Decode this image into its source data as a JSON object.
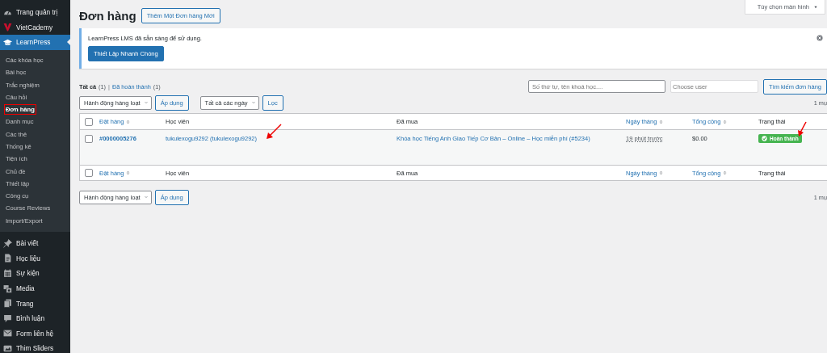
{
  "sidebar": {
    "items": [
      {
        "label": "Trang quản trị",
        "selected": false
      },
      {
        "label": "VietCademy",
        "selected": false
      },
      {
        "label": "LearnPress",
        "selected": true,
        "children": [
          {
            "label": "Các khóa học",
            "selected": false,
            "highlighted": false
          },
          {
            "label": "Bài học",
            "selected": false,
            "highlighted": false
          },
          {
            "label": "Trắc nghiệm",
            "selected": false,
            "highlighted": false
          },
          {
            "label": "Câu hỏi",
            "selected": false,
            "highlighted": false
          },
          {
            "label": "Đơn hàng",
            "selected": true,
            "highlighted": true
          },
          {
            "label": "Danh mục",
            "selected": false,
            "highlighted": false
          },
          {
            "label": "Các thẻ",
            "selected": false,
            "highlighted": false
          },
          {
            "label": "Thống kê",
            "selected": false,
            "highlighted": false
          },
          {
            "label": "Tiện ích",
            "selected": false,
            "highlighted": false
          },
          {
            "label": "Chủ đề",
            "selected": false,
            "highlighted": false
          },
          {
            "label": "Thiết lập",
            "selected": false,
            "highlighted": false
          },
          {
            "label": "Công cụ",
            "selected": false,
            "highlighted": false
          },
          {
            "label": "Course Reviews",
            "selected": false,
            "highlighted": false
          },
          {
            "label": "Import/Export",
            "selected": false,
            "highlighted": false
          }
        ]
      },
      {
        "label": "Bài viết",
        "selected": false
      },
      {
        "label": "Học liệu",
        "selected": false
      },
      {
        "label": "Sự kiện",
        "selected": false
      },
      {
        "label": "Media",
        "selected": false
      },
      {
        "label": "Trang",
        "selected": false
      },
      {
        "label": "Bình luận",
        "selected": false
      },
      {
        "label": "Form liên hệ",
        "selected": false
      },
      {
        "label": "Thim Sliders",
        "selected": false
      }
    ]
  },
  "screen_options": "Tùy chọn màn hình",
  "page_title": "Đơn hàng",
  "add_button": "Thêm Một Đơn hàng Mới",
  "notice": {
    "message": "LearnPress LMS đã sẵn sàng để sử dụng.",
    "button": "Thiết Lập Nhanh Chóng"
  },
  "views_separator": "|",
  "views": [
    {
      "label": "Tất cả",
      "count": "(1)",
      "selected": true
    },
    {
      "label": "Đã hoàn thành",
      "count": "(1)",
      "selected": false
    }
  ],
  "search": {
    "placeholder": "Số thứ tự, tên khoá học....",
    "user_placeholder": "Choose user",
    "button": "Tìm kiếm đơn hàng"
  },
  "top_actions": {
    "bulk": "Hành động hàng loạt",
    "apply": "Áp dụng",
    "date": "Tất cả các ngày",
    "filter": "Lọc",
    "count": "1 mụ"
  },
  "table": {
    "header_checked": false,
    "footer_checked": false,
    "columns": [
      {
        "label": "Đặt hàng",
        "sortable": true
      },
      {
        "label": "Học viên",
        "sortable": false
      },
      {
        "label": "Đã mua",
        "sortable": false
      },
      {
        "label": "Ngày tháng",
        "sortable": true
      },
      {
        "label": "Tổng cộng",
        "sortable": true
      },
      {
        "label": "Trạng thái",
        "sortable": false
      }
    ],
    "rows": [
      {
        "checked": false,
        "order": "#0000005276",
        "student": "tukulexogu9292 (tukulexogu9292)",
        "student_arrow": true,
        "purchased": "Khóa học Tiếng Anh Giao Tiếp Cơ Bản – Online – Học miễn phí (#5234)",
        "date": "19 phút trước",
        "total": "$0.00",
        "status": {
          "label": "Hoàn thành",
          "kind": "completed",
          "arrow": true
        }
      }
    ],
    "footer_columns": [
      {
        "label": "Đặt hàng",
        "sortable": true
      },
      {
        "label": "Học viên",
        "sortable": false
      },
      {
        "label": "Đã mua",
        "sortable": false
      },
      {
        "label": "Ngày tháng",
        "sortable": true
      },
      {
        "label": "Tổng cộng",
        "sortable": true
      },
      {
        "label": "Trạng thái",
        "sortable": false
      }
    ]
  },
  "bottom_actions": {
    "bulk": "Hành động hàng loạt",
    "apply": "Áp dụng",
    "count": "1 mụ"
  }
}
